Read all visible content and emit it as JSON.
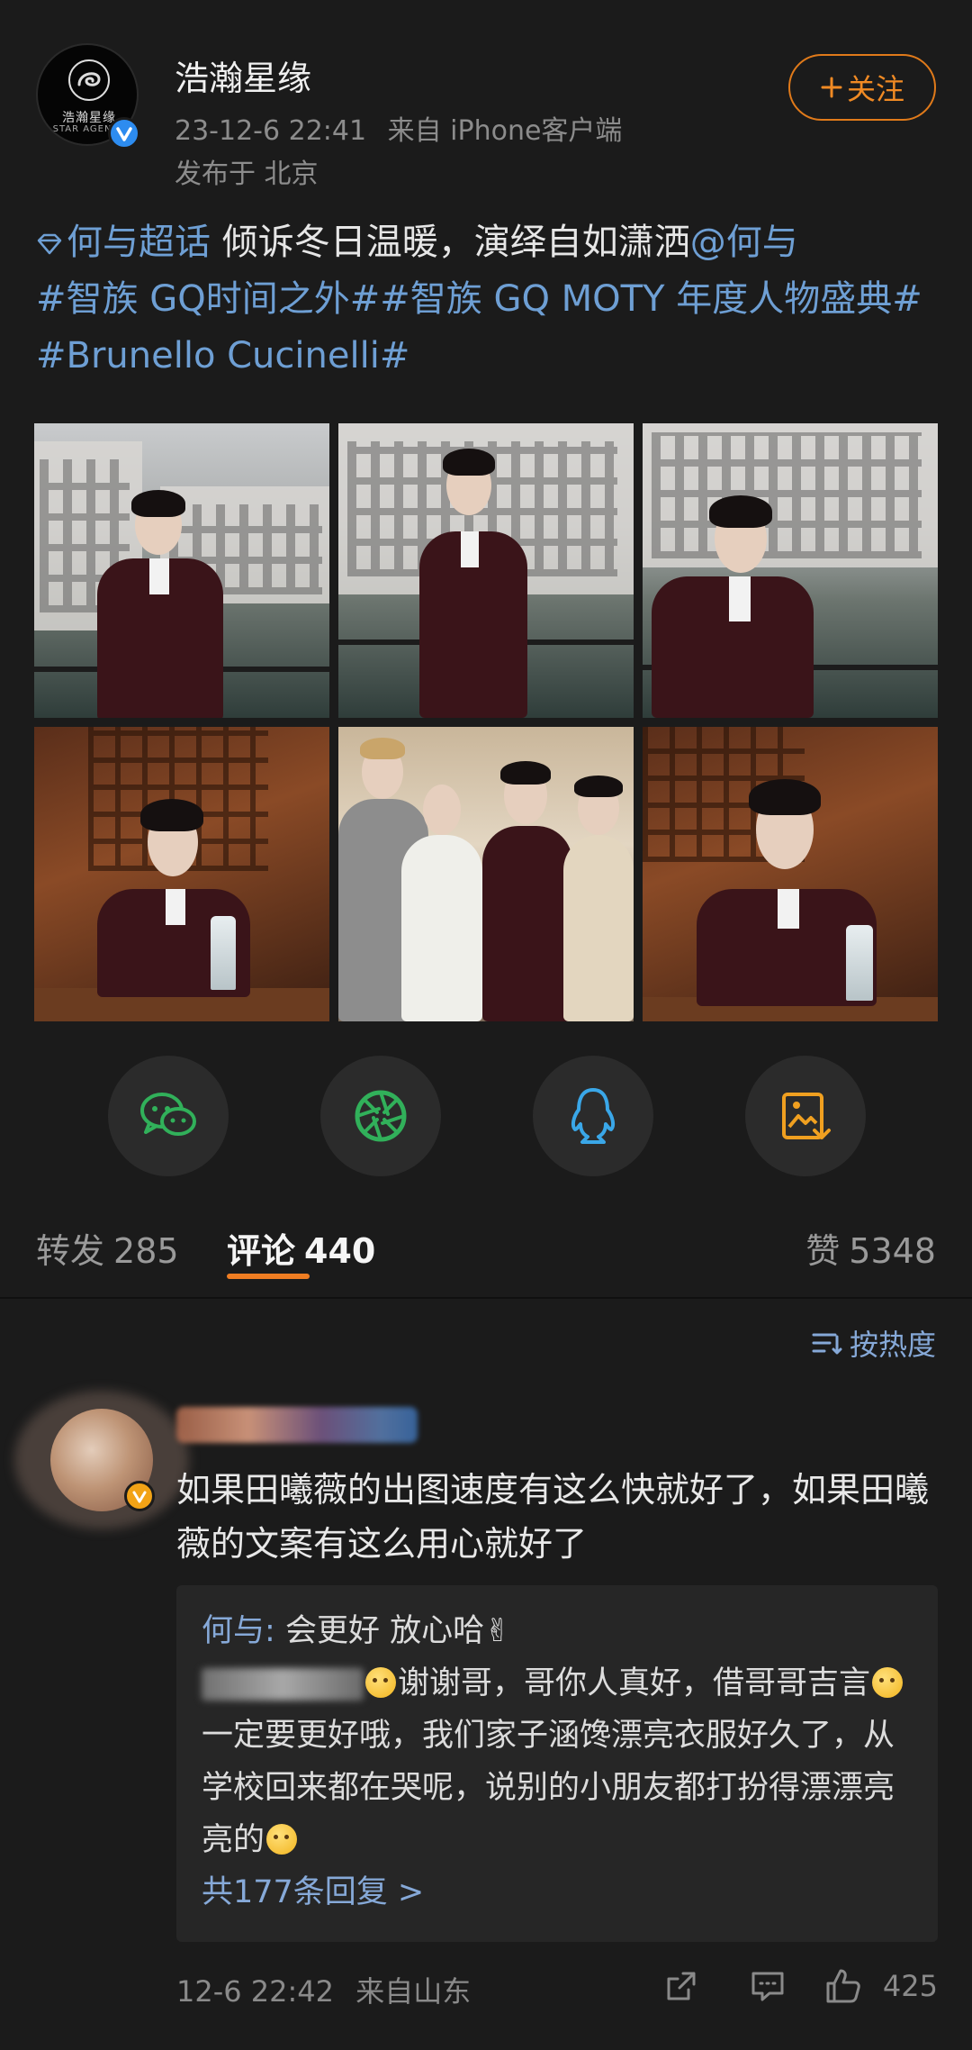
{
  "account": {
    "name": "浩瀚星缘",
    "logo_text": "浩瀚星缘",
    "logo_sub": "STAR AGENCY",
    "date": "23-12-6 22:41",
    "source": "来自 iPhone客户端",
    "location": "发布于 北京",
    "follow_label": "关注"
  },
  "post": {
    "supertopic": "何与超话",
    "text_1": " 倾诉冬日温暖，演绎自如潇洒",
    "mention": "@何与",
    "hashtag_1": "#智族 GQ时间之外#",
    "hashtag_2": "#智族 GQ MOTY 年度人物盛典#",
    "hashtag_3": "#Brunello Cucinelli#"
  },
  "stats": {
    "repost_label": "转发",
    "repost_count": "285",
    "comment_label": "评论",
    "comment_count": "440",
    "like_label": "赞",
    "like_count": "5348"
  },
  "sort": {
    "label": "按热度"
  },
  "comment": {
    "text": "如果田曦薇的出图速度有这么快就好了，如果田曦薇的文案有这么用心就好了",
    "reply_1_author": "何与",
    "reply_1_text": "会更好 放心哈✌",
    "reply_2_text_a": "谢谢哥，哥你人真好，借哥哥吉言",
    "reply_2_text_b": "一定要更好哦，我们家子涵馋漂亮衣服好久了，从学校回来都在哭呢，说别的小朋友都打扮得漂漂亮亮的",
    "more_replies": "共177条回复 >",
    "time": "12-6 22:42",
    "location": "来自山东",
    "likes": "425"
  },
  "colors": {
    "accent": "#ef7d22",
    "link": "#6e9fd4",
    "background": "#1b1b1b"
  }
}
